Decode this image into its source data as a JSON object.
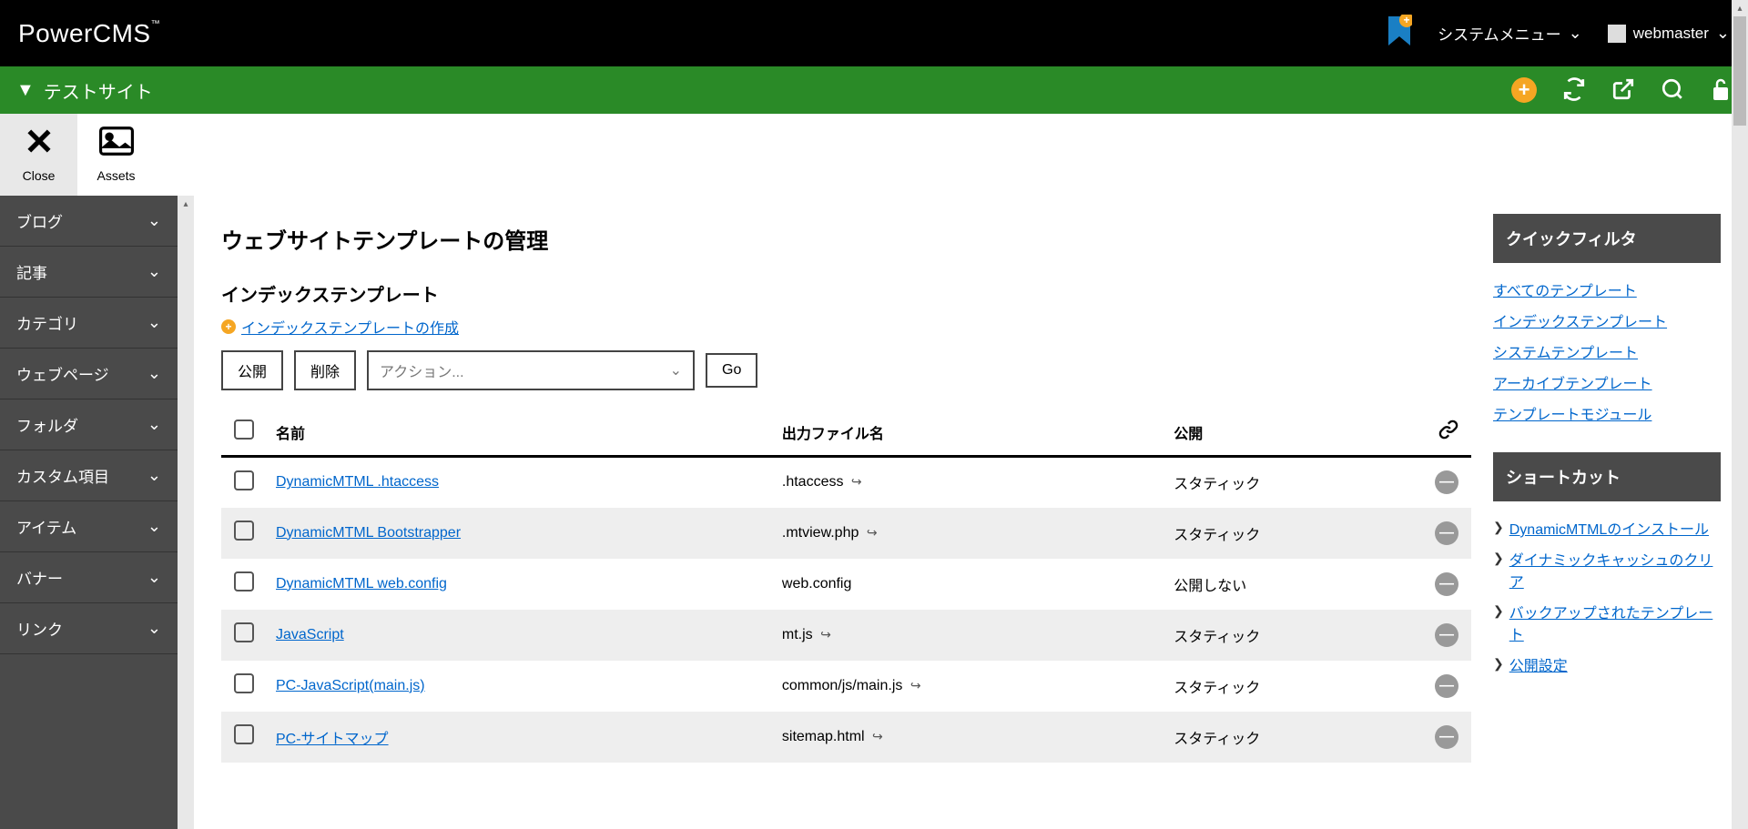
{
  "topbar": {
    "logo": "PowerCMS",
    "logo_tm": "™",
    "system_menu": "システムメニュー",
    "username": "webmaster"
  },
  "greenbar": {
    "site_name": "テストサイト"
  },
  "toolbar": {
    "close": "Close",
    "assets": "Assets"
  },
  "sidebar": {
    "items": [
      {
        "label": "ブログ"
      },
      {
        "label": "記事"
      },
      {
        "label": "カテゴリ"
      },
      {
        "label": "ウェブページ"
      },
      {
        "label": "フォルダ"
      },
      {
        "label": "カスタム項目"
      },
      {
        "label": "アイテム"
      },
      {
        "label": "バナー"
      },
      {
        "label": "リンク"
      }
    ]
  },
  "page": {
    "title": "ウェブサイトテンプレートの管理",
    "section_title": "インデックステンプレート",
    "create_link": "インデックステンプレートの作成",
    "btn_publish": "公開",
    "btn_delete": "削除",
    "action_placeholder": "アクション...",
    "btn_go": "Go",
    "columns": {
      "name": "名前",
      "output": "出力ファイル名",
      "publish": "公開"
    },
    "rows": [
      {
        "name": "DynamicMTML .htaccess",
        "output": ".htaccess",
        "ext": true,
        "publish": "スタティック"
      },
      {
        "name": "DynamicMTML Bootstrapper",
        "output": ".mtview.php",
        "ext": true,
        "publish": "スタティック"
      },
      {
        "name": "DynamicMTML web.config",
        "output": "web.config",
        "ext": false,
        "publish": "公開しない"
      },
      {
        "name": "JavaScript",
        "output": "mt.js",
        "ext": true,
        "publish": "スタティック"
      },
      {
        "name": "PC-JavaScript(main.js)",
        "output": "common/js/main.js",
        "ext": true,
        "publish": "スタティック"
      },
      {
        "name": "PC-サイトマップ",
        "output": "sitemap.html",
        "ext": true,
        "publish": "スタティック"
      }
    ]
  },
  "quickfilter": {
    "title": "クイックフィルタ",
    "links": [
      "すべてのテンプレート",
      "インデックステンプレート",
      "システムテンプレート",
      "アーカイブテンプレート",
      "テンプレートモジュール"
    ]
  },
  "shortcuts": {
    "title": "ショートカット",
    "links": [
      "DynamicMTMLのインストール",
      "ダイナミックキャッシュのクリア",
      "バックアップされたテンプレート",
      "公開設定"
    ]
  }
}
